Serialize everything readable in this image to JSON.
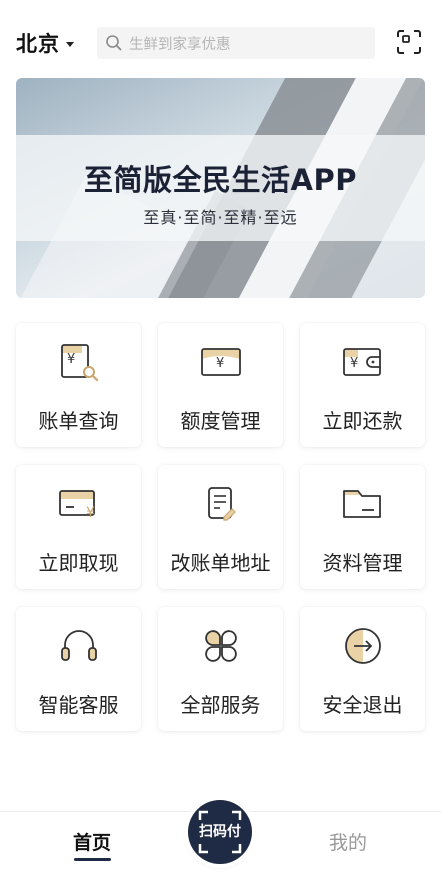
{
  "header": {
    "city": "北京",
    "search_placeholder": "生鲜到家享优惠"
  },
  "banner": {
    "title": "至简版全民生活APP",
    "subtitle": "至真·至简·至精·至远"
  },
  "services": [
    {
      "label": "账单查询",
      "icon": "bill-search-icon"
    },
    {
      "label": "额度管理",
      "icon": "credit-limit-icon"
    },
    {
      "label": "立即还款",
      "icon": "wallet-repay-icon"
    },
    {
      "label": "立即取现",
      "icon": "card-cash-icon"
    },
    {
      "label": "改账单地址",
      "icon": "document-edit-icon"
    },
    {
      "label": "资料管理",
      "icon": "folder-icon"
    },
    {
      "label": "智能客服",
      "icon": "headset-icon"
    },
    {
      "label": "全部服务",
      "icon": "clover-grid-icon"
    },
    {
      "label": "安全退出",
      "icon": "exit-arrow-icon"
    }
  ],
  "bottom_nav": {
    "home": "首页",
    "pay": "扫码付",
    "mine": "我的"
  },
  "colors": {
    "accent_navy": "#1f2a44",
    "icon_gold": "#e8d2a6",
    "icon_dark": "#333333"
  }
}
